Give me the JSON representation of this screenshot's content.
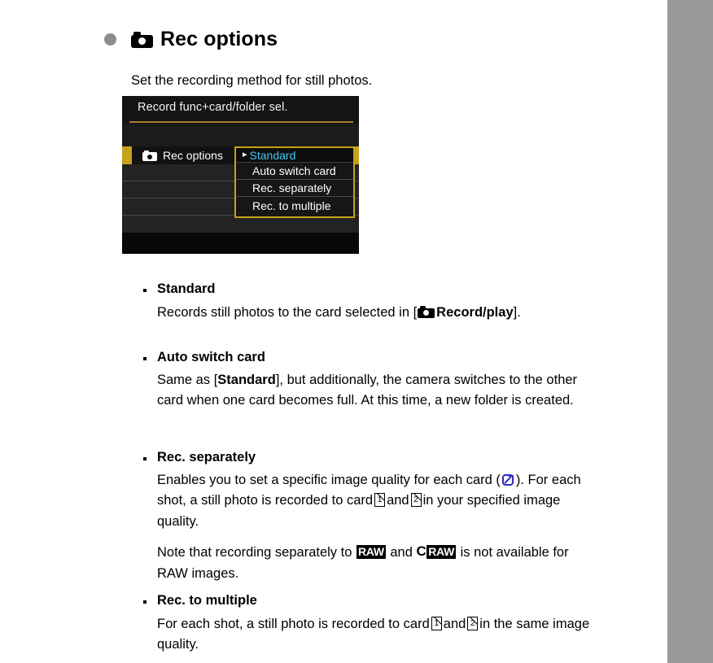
{
  "heading": {
    "icon": "camera-icon",
    "title": "Rec options"
  },
  "intro": "Set the recording method for still photos.",
  "camera_menu": {
    "title": "Record func+card/folder sel.",
    "selected_row_label": "Rec options",
    "selected_row_icon": "camera-icon",
    "caret": "▸",
    "dropdown_options": [
      "Standard",
      "Auto switch card",
      "Rec. separately",
      "Rec. to multiple"
    ],
    "selected_option": "Standard",
    "colors": {
      "highlight": "#c8a01a",
      "selected_text": "#45c8f0",
      "background": "#0a0a0a",
      "row": "#232323"
    }
  },
  "sections": [
    {
      "title": "Standard",
      "body_lead": "Records still photos to the card selected in [",
      "body_bold": "Record/play",
      "body_tail": "]."
    },
    {
      "title": "Auto switch card",
      "body_lead": "Same as [",
      "body_bold": "Standard",
      "body_tail": "], but additionally, the camera switches to the other card when one card becomes full. At this time, a new folder is created."
    },
    {
      "title": "Rec. separately",
      "para1_a": "Enables you to set a specific image quality for each card (",
      "para1_b": "). For each shot, a still photo is recorded to card",
      "para1_c": "and",
      "para1_d": "in your specified image quality.",
      "para2_a": "Note that recording separately to",
      "para2_raw1": "RAW",
      "para2_b": "and",
      "para2_c": "C",
      "para2_raw2": "RAW",
      "para2_d": "is not available for RAW images."
    },
    {
      "title": "Rec. to multiple",
      "body_a": "For each shot, a still photo is recorded to card",
      "body_b": "and",
      "body_c": "in the same image quality."
    }
  ],
  "card_labels": {
    "card1": "1",
    "card2": "2"
  }
}
